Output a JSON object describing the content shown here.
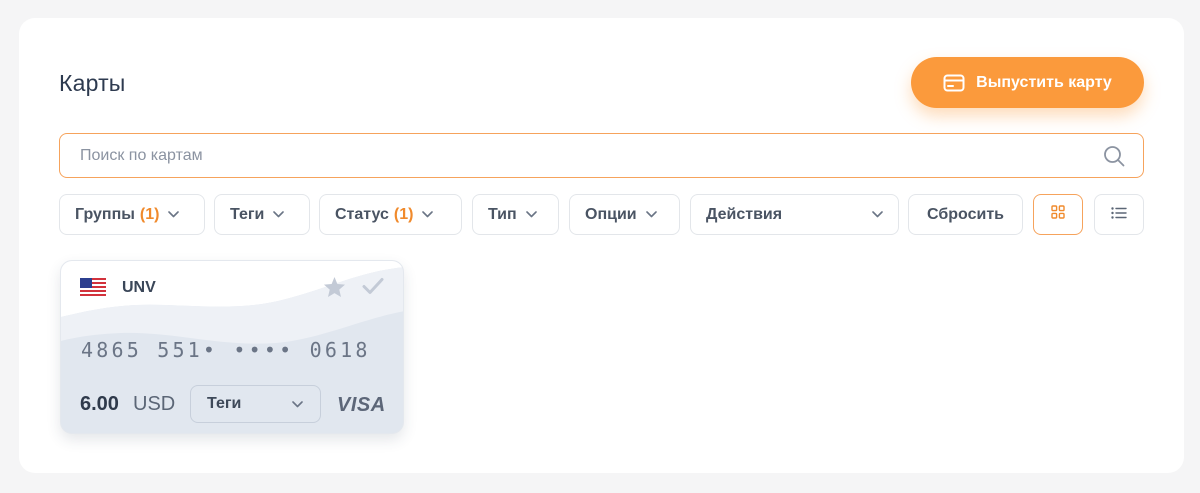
{
  "page": {
    "title": "Карты",
    "issue_button_label": "Выпустить карту"
  },
  "search": {
    "placeholder": "Поиск по картам",
    "value": ""
  },
  "filters": {
    "groups_label": "Группы",
    "groups_count": "(1)",
    "tags_label": "Теги",
    "status_label": "Статус",
    "status_count": "(1)",
    "type_label": "Тип",
    "options_label": "Опции",
    "actions_label": "Действия",
    "reset_label": "Сбросить"
  },
  "view_modes": [
    "grid-icon",
    "list-icon"
  ],
  "active_view": "grid",
  "cards": [
    {
      "currency_code": "UNV",
      "flag": "us-flag-icon",
      "number": "4865 551• •••• 0618",
      "balance": "6.00",
      "currency": "USD",
      "tags_label": "Теги",
      "network": "VISA",
      "favorite": false,
      "selected": false
    }
  ],
  "colors": {
    "accent": "#fb9a3c",
    "accent_text": "#f08a2c",
    "card_bg": "#e1e7ef"
  }
}
